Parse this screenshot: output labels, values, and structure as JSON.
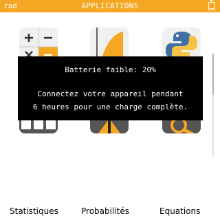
{
  "statusbar": {
    "angle_mode": "rad",
    "title": "APPLICATIONS",
    "battery_level": 0.2
  },
  "apps": [
    {
      "label": "Statistiques",
      "icon": "calculation-operators-icon"
    },
    {
      "label": "Probabilités",
      "icon": "probability-distribution-icon"
    },
    {
      "label": "Equations",
      "icon": "python-logo-icon"
    }
  ],
  "modal": {
    "line1": "Batterie faible: 20%",
    "line2": "Connectez votre appareil pendant",
    "line3": "6 heures pour une charge complète."
  },
  "colors": {
    "accent": "#f5a623",
    "modal_bg": "#000000",
    "modal_text": "#ffffff",
    "python_blue": "#3f6fa3",
    "python_yellow": "#f5c242"
  }
}
